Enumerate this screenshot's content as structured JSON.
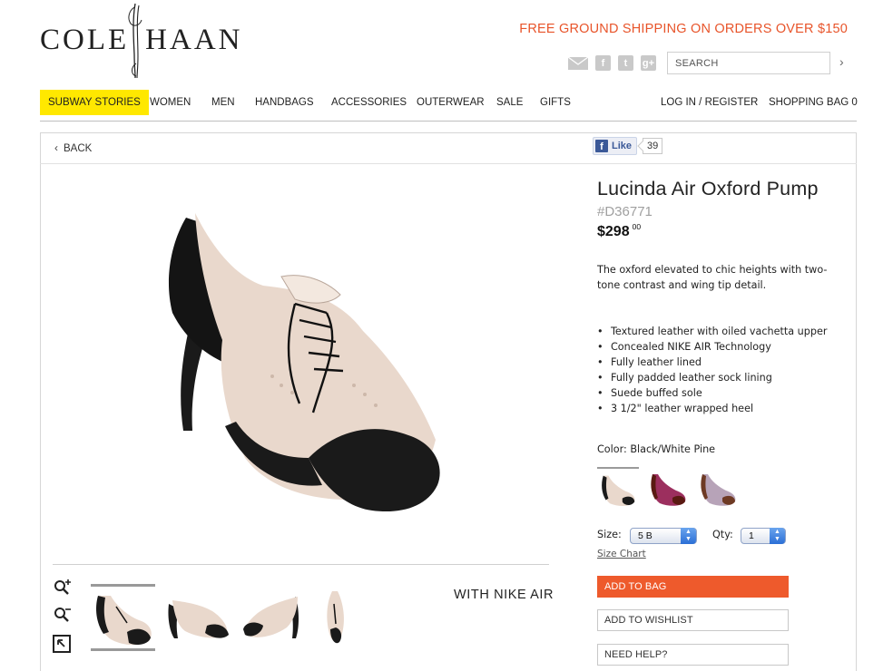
{
  "brand": {
    "left": "COLE",
    "right": "HAAN"
  },
  "header": {
    "promo": "FREE GROUND SHIPPING ON ORDERS OVER $150",
    "search_placeholder": "SEARCH",
    "social_icons": [
      "mail-icon",
      "facebook-icon",
      "twitter-icon",
      "google-plus-icon"
    ]
  },
  "nav": {
    "items": [
      "SUBWAY STORIES",
      "WOMEN",
      "MEN",
      "HANDBAGS",
      "ACCESSORIES",
      "OUTERWEAR",
      "SALE",
      "GIFTS"
    ],
    "login": "LOG IN / REGISTER",
    "bag": "SHOPPING BAG 0",
    "highlight_color": "#ffe800"
  },
  "toolbar": {
    "back": "BACK",
    "like_label": "Like",
    "like_count": "39"
  },
  "product": {
    "title": "Lucinda Air Oxford Pump",
    "sku": "#D36771",
    "price_main": "$298",
    "price_cents": "00",
    "description": "The oxford elevated to chic heights with two-tone contrast and wing tip detail.",
    "features": [
      "Textured leather with oiled vachetta upper",
      "Concealed NIKE AIR Technology",
      "Fully leather lined",
      "Fully padded leather sock lining",
      "Suede buffed sole",
      "3 1/2\" leather wrapped heel"
    ],
    "color_label": "Color: Black/White Pine",
    "size_label": "Size:",
    "size_value": "5 B",
    "qty_label": "Qty:",
    "qty_value": "1",
    "size_chart": "Size Chart",
    "add_to_bag": "ADD TO BAG",
    "add_to_wishlist": "ADD TO WISHLIST",
    "need_help": "NEED HELP?",
    "badge": "WITH NIKE AIR",
    "accent_color": "#ee5a2c"
  }
}
